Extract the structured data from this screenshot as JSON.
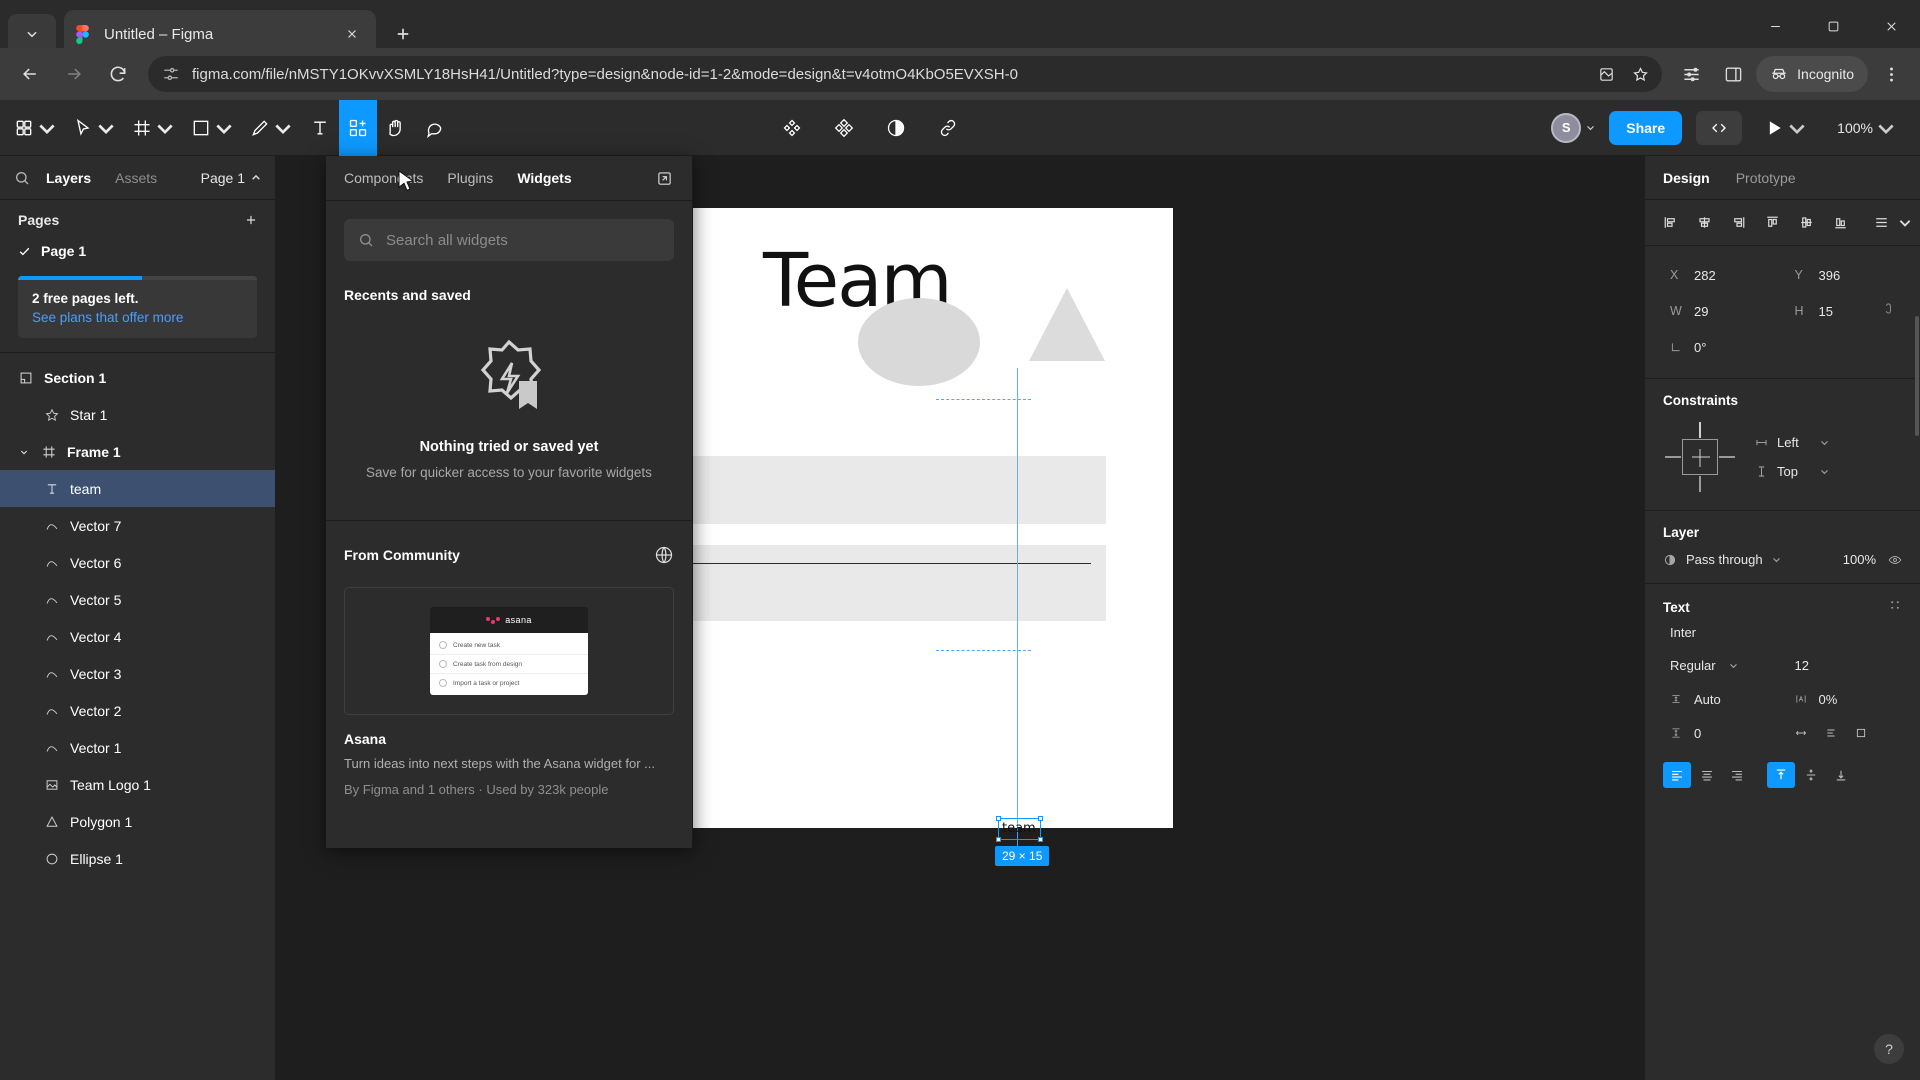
{
  "browser": {
    "tab": {
      "title": "Untitled – Figma",
      "favicon": "figma-logo-icon"
    },
    "url": "figma.com/file/nMSTY1OKvvXSMLY18HsH41/Untitled?type=design&node-id=1-2&mode=design&t=v4otmO4KbO5EVXSH-0",
    "incognito_label": "Incognito",
    "new_tab_label": "+",
    "accent": "#0d99ff"
  },
  "toolbar": {
    "tools": [
      {
        "name": "figma-menu",
        "glyph": "menu"
      },
      {
        "name": "move-tool",
        "glyph": "cursor"
      },
      {
        "name": "frame-tool",
        "glyph": "frame"
      },
      {
        "name": "shape-tool",
        "glyph": "square"
      },
      {
        "name": "pen-tool",
        "glyph": "pen"
      },
      {
        "name": "text-tool",
        "glyph": "text"
      },
      {
        "name": "resources-tool",
        "glyph": "components"
      },
      {
        "name": "hand-tool",
        "glyph": "hand"
      },
      {
        "name": "comment-tool",
        "glyph": "comment"
      }
    ],
    "center_tools": [
      {
        "name": "component-icon"
      },
      {
        "name": "plugin-icon"
      },
      {
        "name": "contrast-icon"
      },
      {
        "name": "link-icon"
      }
    ],
    "avatar_initial": "S",
    "share_label": "Share",
    "dev_mode_label": "</>",
    "present_label": "play",
    "zoom_level": "100%"
  },
  "left_panel": {
    "tabs": [
      {
        "label": "Layers",
        "active": true
      },
      {
        "label": "Assets",
        "active": false
      }
    ],
    "page_selector": "Page 1",
    "pages_title": "Pages",
    "pages": [
      {
        "label": "Page 1",
        "checked": true
      }
    ],
    "upsell": {
      "title": "2 free pages left.",
      "link": "See plans that offer more",
      "progress": 52
    },
    "layers": [
      {
        "label": "Section 1",
        "icon": "section-icon",
        "depth": 0,
        "bold": true,
        "selected": false,
        "caret": false
      },
      {
        "label": "Star 1",
        "icon": "star-icon",
        "depth": 1,
        "bold": false,
        "selected": false,
        "caret": false
      },
      {
        "label": "Frame 1",
        "icon": "frame-icon",
        "depth": 0,
        "bold": true,
        "selected": false,
        "caret": true
      },
      {
        "label": "team",
        "icon": "text-icon",
        "depth": 1,
        "bold": false,
        "selected": true,
        "caret": false
      },
      {
        "label": "Vector 7",
        "icon": "vector-icon",
        "depth": 1,
        "bold": false,
        "selected": false,
        "caret": false
      },
      {
        "label": "Vector 6",
        "icon": "vector-icon",
        "depth": 1,
        "bold": false,
        "selected": false,
        "caret": false
      },
      {
        "label": "Vector 5",
        "icon": "vector-icon",
        "depth": 1,
        "bold": false,
        "selected": false,
        "caret": false
      },
      {
        "label": "Vector 4",
        "icon": "vector-icon",
        "depth": 1,
        "bold": false,
        "selected": false,
        "caret": false
      },
      {
        "label": "Vector 3",
        "icon": "vector-icon",
        "depth": 1,
        "bold": false,
        "selected": false,
        "caret": false
      },
      {
        "label": "Vector 2",
        "icon": "vector-icon",
        "depth": 1,
        "bold": false,
        "selected": false,
        "caret": false
      },
      {
        "label": "Vector 1",
        "icon": "vector-icon",
        "depth": 1,
        "bold": false,
        "selected": false,
        "caret": false
      },
      {
        "label": "Team Logo 1",
        "icon": "image-icon",
        "depth": 1,
        "bold": false,
        "selected": false,
        "caret": false
      },
      {
        "label": "Polygon 1",
        "icon": "polygon-icon",
        "depth": 1,
        "bold": false,
        "selected": false,
        "caret": false
      },
      {
        "label": "Ellipse 1",
        "icon": "ellipse-icon",
        "depth": 1,
        "bold": false,
        "selected": false,
        "caret": false
      }
    ]
  },
  "widgets_popover": {
    "tabs": [
      {
        "label": "Components",
        "active": false
      },
      {
        "label": "Plugins",
        "active": false
      },
      {
        "label": "Widgets",
        "active": true
      }
    ],
    "search_placeholder": "Search all widgets",
    "search_value": "",
    "recents_title": "Recents and saved",
    "empty_title": "Nothing tried or saved yet",
    "empty_subtitle": "Save for quicker access to your favorite widgets",
    "community_title": "From Community",
    "card": {
      "name": "Asana",
      "description": "Turn ideas into next steps with the Asana widget for ...",
      "meta": "By Figma and 1 others · Used by 323k people",
      "thumb_brand": "asana",
      "thumb_rows": [
        "Create new task",
        "Create task from design",
        "Import a task or project"
      ]
    }
  },
  "canvas": {
    "artboard_text": "Team",
    "selection_text": "team",
    "selection_dims": "29 × 15"
  },
  "right_panel": {
    "tabs": [
      {
        "label": "Design",
        "active": true
      },
      {
        "label": "Prototype",
        "active": false
      }
    ],
    "position": {
      "x_label": "X",
      "x_value": "282",
      "y_label": "Y",
      "y_value": "396",
      "w_label": "W",
      "w_value": "29",
      "h_label": "H",
      "h_value": "15",
      "rotation_value": "0°"
    },
    "constraints": {
      "title": "Constraints",
      "horizontal": "Left",
      "vertical": "Top"
    },
    "layer": {
      "title": "Layer",
      "blend_mode": "Pass through",
      "opacity": "100%"
    },
    "text": {
      "title": "Text",
      "font_family": "Inter",
      "font_style": "Regular",
      "font_size": "12",
      "line_height_label": "Auto",
      "letter_spacing": "0%",
      "paragraph_spacing": "0"
    },
    "help_label": "?"
  }
}
